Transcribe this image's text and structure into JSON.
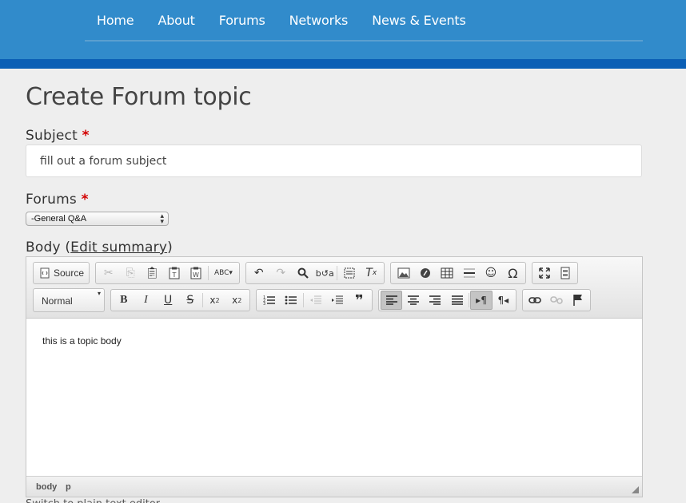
{
  "nav": {
    "items": [
      "Home",
      "About",
      "Forums",
      "Networks",
      "News & Events"
    ]
  },
  "page": {
    "title": "Create Forum topic"
  },
  "subject": {
    "label": "Subject",
    "required": "*",
    "value": "fill out a forum subject"
  },
  "forums": {
    "label": "Forums",
    "required": "*",
    "selected": "-General Q&A"
  },
  "body": {
    "label": "Body (",
    "link": "Edit summary",
    "label_end": ")"
  },
  "editor": {
    "source_label": "Source",
    "format_label": "Normal",
    "content": "this is a topic body",
    "status": [
      "body",
      "p"
    ]
  },
  "below_text": "Switch to plain text editor",
  "colors": {
    "header": "#318bcb",
    "header_strip": "#0b5fb5",
    "required": "#d20000"
  }
}
